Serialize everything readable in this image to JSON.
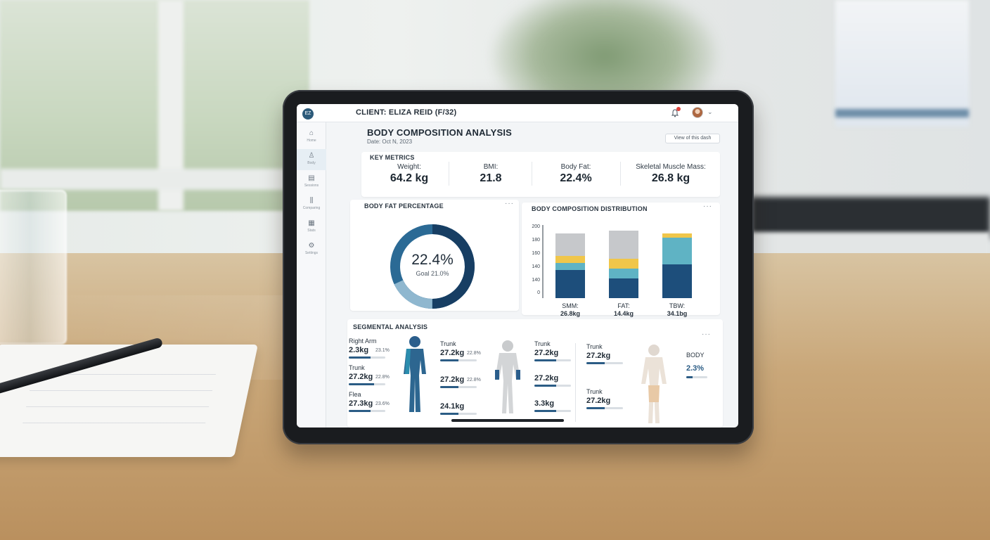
{
  "header": {
    "logo": "EZ",
    "client": "CLIENT: ELIZA REID (F/32)"
  },
  "sidebar": {
    "items": [
      {
        "label": "Home",
        "icon": "home-icon",
        "glyph": "⌂"
      },
      {
        "label": "Body",
        "icon": "body-icon",
        "glyph": "♙"
      },
      {
        "label": "Sessions",
        "icon": "sessions-icon",
        "glyph": "▤"
      },
      {
        "label": "Comparing",
        "icon": "comparing-icon",
        "glyph": "⫼"
      },
      {
        "label": "Stats",
        "icon": "stats-icon",
        "glyph": "▦"
      },
      {
        "label": "Settings",
        "icon": "settings-icon",
        "glyph": "⚙"
      }
    ],
    "active": 1
  },
  "page": {
    "title": "BODY COMPOSITION ANALYSIS",
    "date": "Date: Oct N, 2023",
    "view_button": "View of this dash"
  },
  "key_metrics": {
    "title": "KEY METRICS",
    "items": [
      {
        "label": "Weight:",
        "value": "64.2 kg"
      },
      {
        "label": "BMI:",
        "value": "21.8"
      },
      {
        "label": "Body Fat:",
        "value": "22.4%"
      },
      {
        "label": "Skeletal Muscle Mass:",
        "value": "26.8 kg"
      }
    ]
  },
  "body_fat": {
    "title": "BODY FAT PERCENTAGE",
    "value_text": "22.4%",
    "goal_text": "Goal 21.0%"
  },
  "distribution": {
    "title": "BODY COMPOSITION DISTRIBUTION"
  },
  "chart_data": {
    "type": "bar",
    "stacked": true,
    "title": "BODY COMPOSITION DISTRIBUTION",
    "y_ticks": [
      "200",
      "180",
      "160",
      "140",
      "140",
      "0"
    ],
    "categories": [
      {
        "name": "SMM:",
        "value": "26.8kg"
      },
      {
        "name": "FAT:",
        "value": "14.4kg"
      },
      {
        "name": "TBW:",
        "value": "34.1bg"
      }
    ],
    "series": [
      {
        "color": "#1d4e7b",
        "values": [
          40,
          28,
          48
        ]
      },
      {
        "color": "#5fb3c4",
        "values": [
          10,
          14,
          38
        ]
      },
      {
        "color": "#f0c64a",
        "values": [
          10,
          14,
          6
        ]
      },
      {
        "color": "#c6c8cb",
        "values": [
          32,
          40,
          0
        ]
      }
    ],
    "ylim": [
      0,
      100
    ]
  },
  "segmental": {
    "title": "SEGMENTAL ANALYSIS",
    "col1": [
      {
        "name": "Right Arm",
        "value": "2.3kg",
        "pct": "23.1%",
        "fill": 0.6
      },
      {
        "name": "Trunk",
        "value": "27.2kg",
        "pct": "22.8%",
        "fill": 0.7
      },
      {
        "name": "Flea",
        "value": "27.3kg",
        "pct": "23.6%",
        "fill": 0.6
      }
    ],
    "col2": [
      {
        "name": "Trunk",
        "value": "27.2kg",
        "pct": "22.8%",
        "fill": 0.5
      },
      {
        "name": "",
        "value": "27.2kg",
        "pct": "22.8%",
        "fill": 0.5
      },
      {
        "name": "",
        "value": "24.1kg",
        "pct": "",
        "fill": 0.5
      }
    ],
    "col3": [
      {
        "name": "Trunk",
        "value": "27.2kg",
        "fill": 0.6
      },
      {
        "name": "",
        "value": "27.2kg",
        "fill": 0.6
      },
      {
        "name": "",
        "value": "3.3kg",
        "fill": 0.6
      }
    ],
    "col4": [
      {
        "name": "Trunk",
        "value": "27.2kg",
        "fill": 0.5
      },
      {
        "name": "Trunk",
        "value": "27.2kg",
        "fill": 0.5
      }
    ],
    "body_label": "BODY",
    "body_pct": "2.3%"
  }
}
